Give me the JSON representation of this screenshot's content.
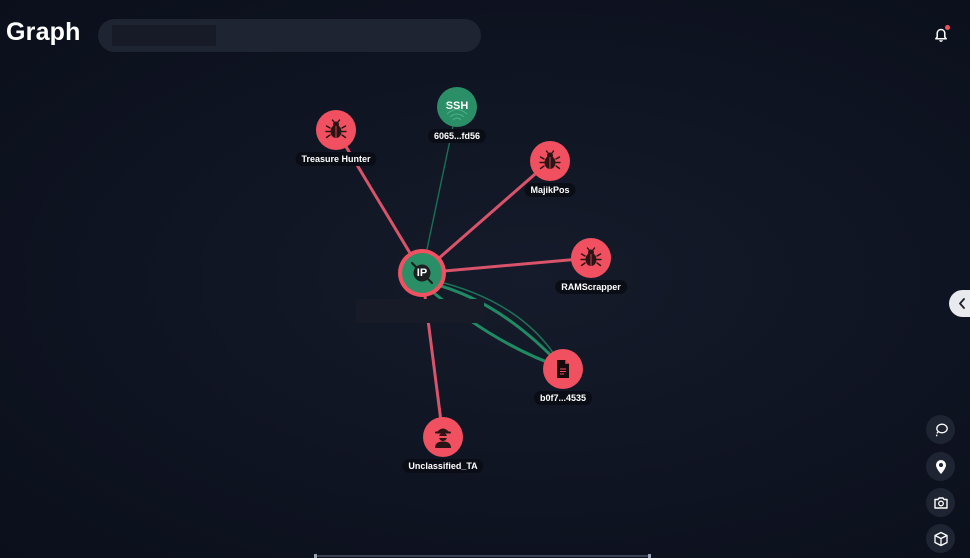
{
  "app_title": "Graph",
  "search": {
    "value": "",
    "placeholder": ""
  },
  "toolbar": {
    "notification_icon": "bell-icon",
    "collapse_icon": "chevron-left-icon",
    "tools": [
      "lasso-icon",
      "location-pin-icon",
      "camera-icon",
      "cube-icon"
    ]
  },
  "colors": {
    "threat_red": "#f0505f",
    "node_green": "#2a8f66",
    "edge_red": "#d0505c",
    "edge_green": "#1f8a63"
  },
  "graph": {
    "center_label": "IP",
    "nodes": [
      {
        "id": "ip",
        "label": "",
        "icon_text": "IP",
        "kind": "ip"
      },
      {
        "id": "ssh",
        "label": "6065...fd56",
        "icon_text": "SSH",
        "kind": "ssh"
      },
      {
        "id": "treasure",
        "label": "Treasure Hunter",
        "icon_text": "",
        "kind": "malware"
      },
      {
        "id": "majik",
        "label": "MajikPos",
        "icon_text": "",
        "kind": "malware"
      },
      {
        "id": "ram",
        "label": "RAMScrapper",
        "icon_text": "",
        "kind": "malware"
      },
      {
        "id": "file",
        "label": "b0f7...4535",
        "icon_text": "",
        "kind": "file"
      },
      {
        "id": "ta",
        "label": "Unclassified_TA",
        "icon_text": "",
        "kind": "actor"
      }
    ]
  }
}
